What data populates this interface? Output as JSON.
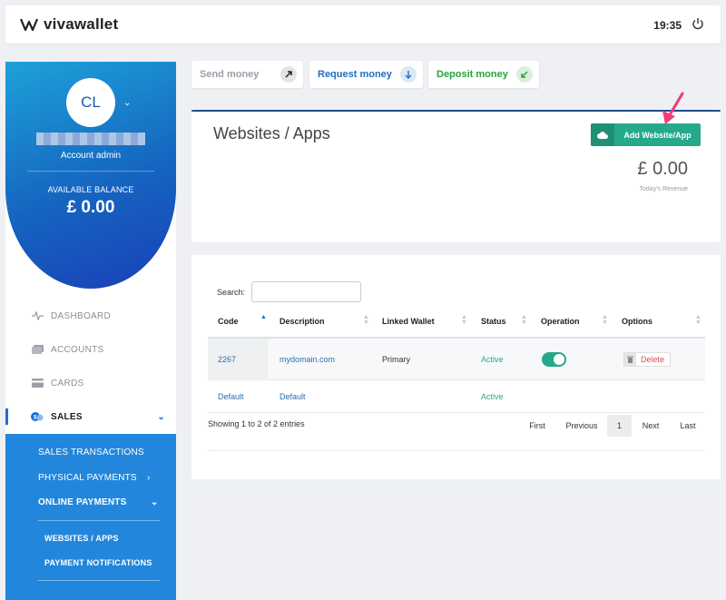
{
  "header": {
    "brand": "vivawallet",
    "time": "19:35"
  },
  "sidebar": {
    "avatar_initials": "CL",
    "role": "Account admin",
    "balance_label": "AVAILABLE BALANCE",
    "balance_value": "£ 0.00",
    "nav": [
      {
        "label": "DASHBOARD"
      },
      {
        "label": "ACCOUNTS"
      },
      {
        "label": "CARDS"
      },
      {
        "label": "SALES"
      }
    ],
    "sales_sub": [
      {
        "label": "SALES TRANSACTIONS"
      },
      {
        "label": "PHYSICAL PAYMENTS"
      },
      {
        "label": "ONLINE PAYMENTS"
      }
    ],
    "online_sub": [
      {
        "label": "WEBSITES / APPS"
      },
      {
        "label": "PAYMENT NOTIFICATIONS"
      }
    ]
  },
  "actions": [
    {
      "label": "Send money",
      "color": "#9aa0a8"
    },
    {
      "label": "Request money",
      "color": "#1e6fc0"
    },
    {
      "label": "Deposit money",
      "color": "#27a23b"
    }
  ],
  "page": {
    "title": "Websites / Apps",
    "add_button": "Add Website/App",
    "revenue_value": "£ 0.00",
    "revenue_label": "Today's Revenue"
  },
  "table": {
    "search_label": "Search:",
    "search_value": "",
    "columns": [
      "Code",
      "Description",
      "Linked Wallet",
      "Status",
      "Operation",
      "Options"
    ],
    "rows": [
      {
        "code": "2267",
        "description": "mydomain.com",
        "linked_wallet": "Primary",
        "status": "Active",
        "operation_on": true,
        "option": "Delete"
      },
      {
        "code": "Default",
        "description": "Default",
        "linked_wallet": "",
        "status": "Active",
        "operation_on": false,
        "option": ""
      }
    ],
    "info": "Showing 1 to 2 of 2 entries",
    "pagination": {
      "first": "First",
      "previous": "Previous",
      "current": "1",
      "next": "Next",
      "last": "Last"
    }
  },
  "colors": {
    "accent_blue": "#1a6fd6",
    "accent_green": "#26a98b",
    "danger": "#e0455a",
    "annotation_arrow": "#ef3b78"
  }
}
